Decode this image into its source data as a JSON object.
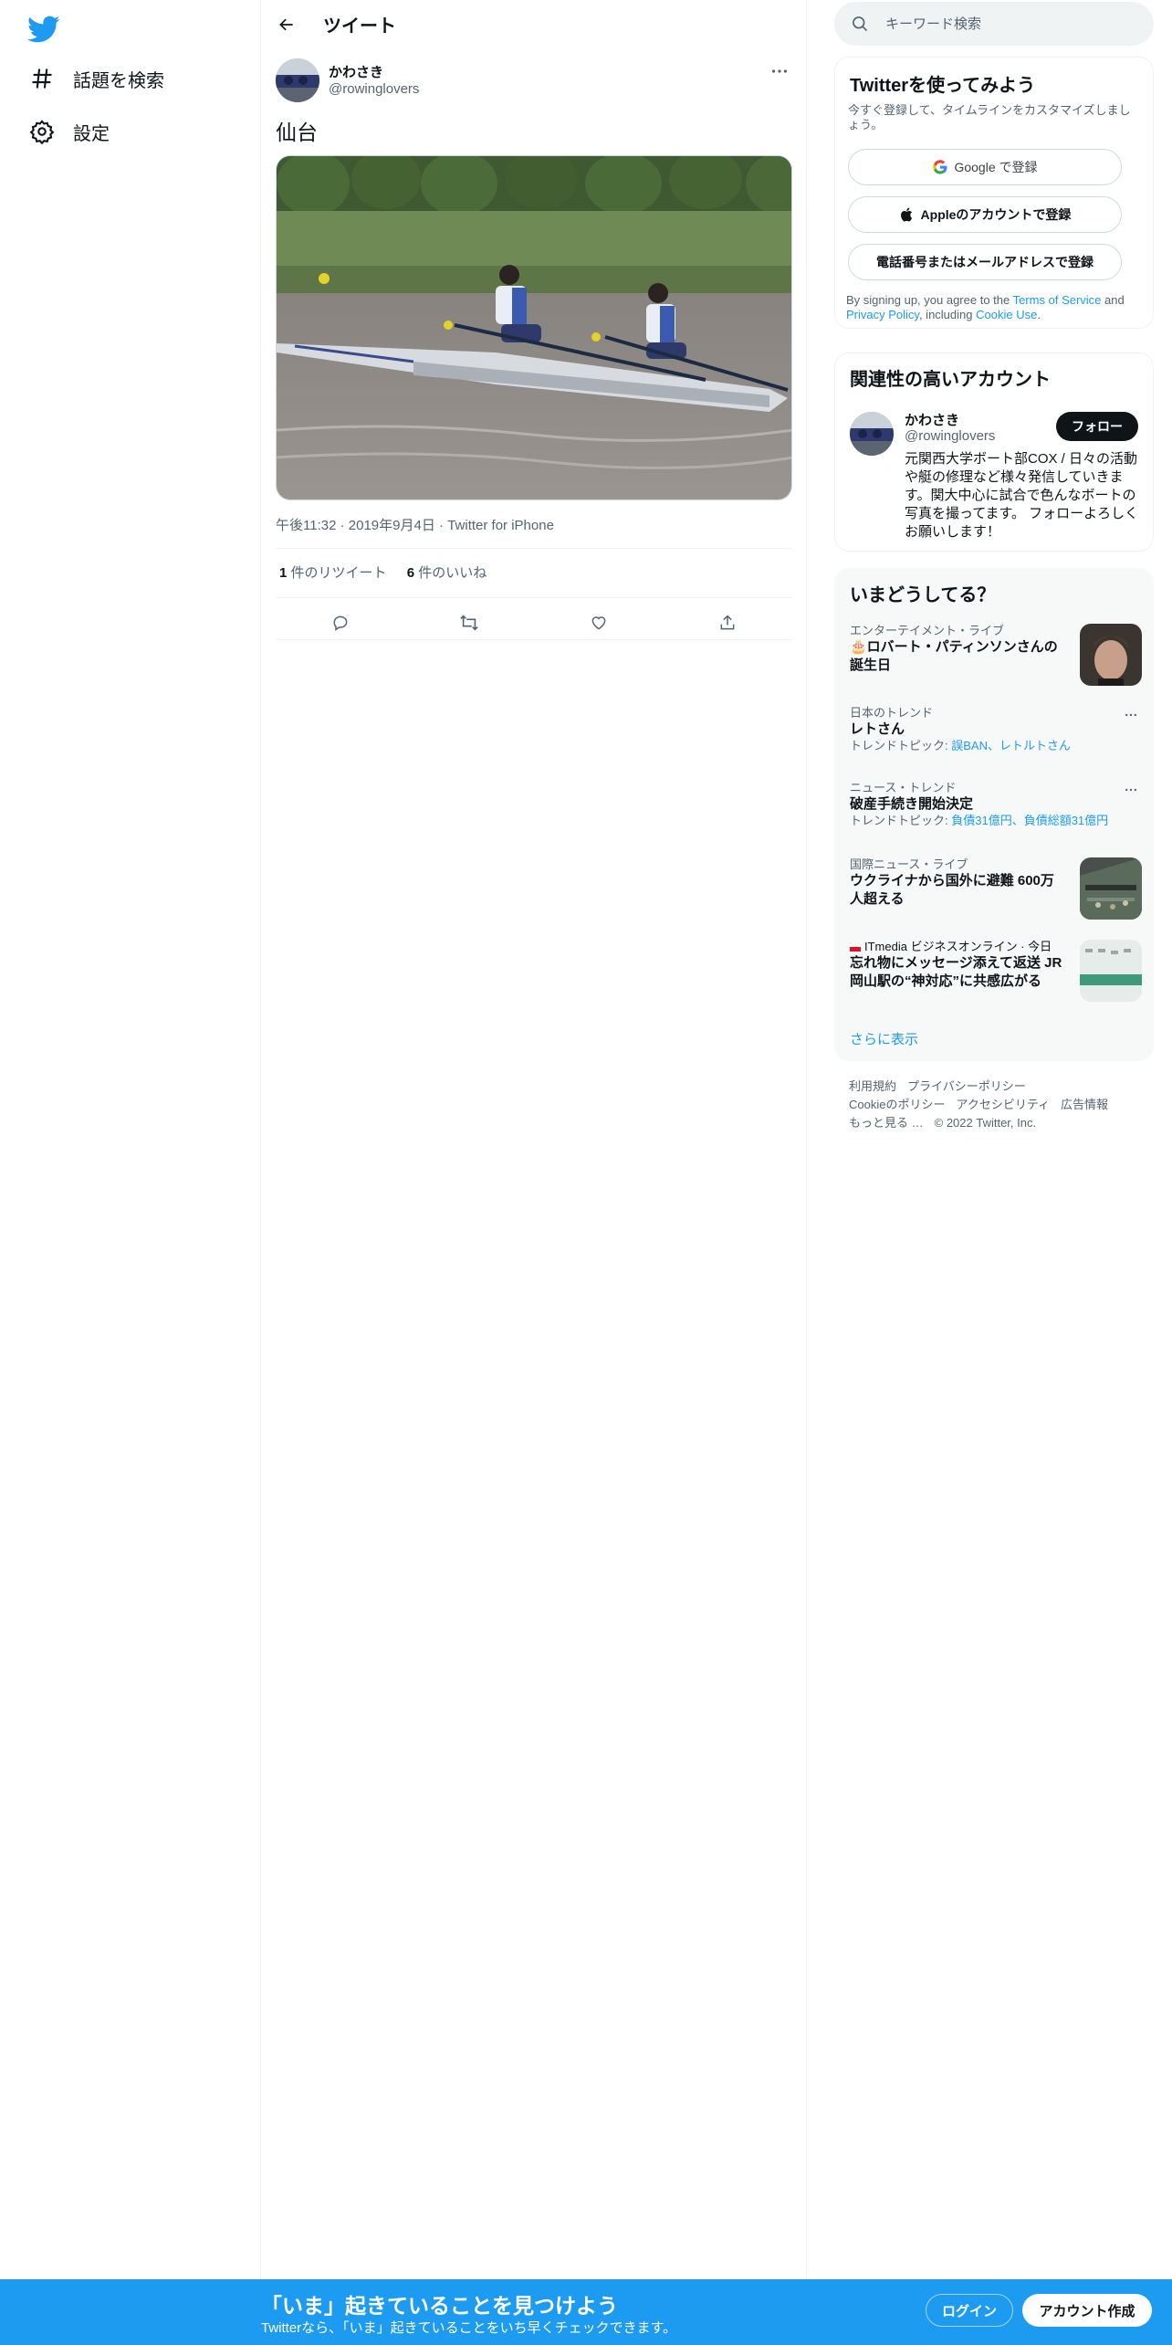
{
  "colors": {
    "accent": "#1d9bf0",
    "text": "#0f1419",
    "secondary": "#536471",
    "border": "#eff3f4"
  },
  "nav": {
    "logo_icon": "twitter-bird-icon",
    "items": [
      {
        "label": "話題を検索",
        "icon": "hashtag-icon"
      },
      {
        "label": "設定",
        "icon": "gear-icon"
      }
    ]
  },
  "header": {
    "title": "ツイート",
    "back_icon": "arrow-left-icon"
  },
  "tweet": {
    "author_name": "かわさき",
    "author_handle": "@rowinglovers",
    "text": "仙台",
    "media_description_icon": "rowing-photo",
    "time": "午後11:32",
    "date": "2019年9月4日",
    "source": "Twitter for iPhone",
    "retweet_count": "1",
    "retweet_label": " 件のリツイート",
    "like_count": "6",
    "like_label": " 件のいいね",
    "separator": "·"
  },
  "search": {
    "placeholder": "キーワード検索"
  },
  "signup_card": {
    "title": "Twitterを使ってみよう",
    "subtitle": "今すぐ登録して、タイムラインをカスタマイズしましょう。",
    "google_label": "Google で登録",
    "apple_label": "Appleのアカウントで登録",
    "phone_label": "電話番号またはメールアドレスで登録",
    "legal_prefix": "By signing up, you agree to the ",
    "terms": "Terms of Service",
    "and": " and ",
    "privacy": "Privacy Policy",
    "including": ", including ",
    "cookie": "Cookie Use",
    "period": "."
  },
  "related_card": {
    "title": "関連性の高いアカウント",
    "name": "かわさき",
    "handle": "@rowinglovers",
    "follow_label": "フォロー",
    "bio": "元関西大学ボート部COX / 日々の活動や艇の修理など様々発信していきます。関大中心に試合で色んなボートの写真を撮ってます。 フォローよろしくお願いします！"
  },
  "trends_card": {
    "title": "いまどうしてる？",
    "items": [
      {
        "category": "エンターテイメント・ライブ",
        "title": "🎂ロバート・パティンソンさんの誕生日"
      },
      {
        "category": "日本のトレンド",
        "title": "レトさん",
        "sub_prefix": "トレンドトピック: ",
        "topics": "誤BAN、レトルトさん"
      },
      {
        "category": "ニュース・トレンド",
        "title": "破産手続き開始決定",
        "sub_prefix": "トレンドトピック: ",
        "topics": "負債31億円、負債総額31億円"
      },
      {
        "category": "国際ニュース・ライブ",
        "title": "ウクライナから国外に避難 600万人超える"
      },
      {
        "category": "ITmedia ビジネスオンライン · 今日",
        "title": "忘れ物にメッセージ添えて返送 JR岡山駅の“神対応”に共感広がる"
      }
    ],
    "show_more": "さらに表示"
  },
  "footer": {
    "links_row1": [
      "利用規約",
      "プライバシーポリシー"
    ],
    "links_row2": [
      "Cookieのポリシー",
      "アクセシビリティ",
      "広告情報"
    ],
    "more": "もっと見る …",
    "copyright": "© 2022 Twitter, Inc."
  },
  "bottom_bar": {
    "title": "「いま」起きていることを見つけよう",
    "subtitle": "Twitterなら、「いま」起きていることをいち早くチェックできます。",
    "login": "ログイン",
    "signup": "アカウント作成"
  }
}
